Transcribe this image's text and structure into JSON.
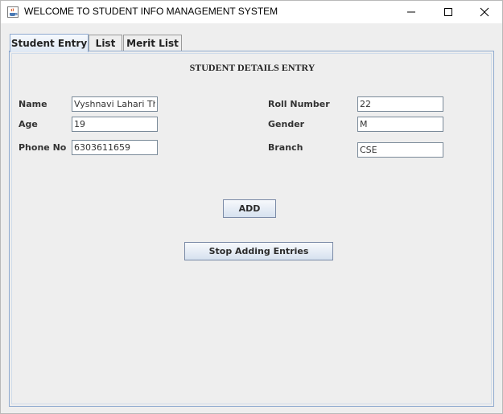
{
  "window": {
    "title": "WELCOME TO STUDENT INFO MANAGEMENT SYSTEM",
    "icon": "java-cup-icon"
  },
  "tabs": [
    {
      "label": "Student Entry",
      "active": true
    },
    {
      "label": "List",
      "active": false
    },
    {
      "label": "Merit List",
      "active": false
    }
  ],
  "form": {
    "heading": "STUDENT DETAILS ENTRY",
    "name": {
      "label": "Name",
      "value": "Vyshnavi Lahari Th"
    },
    "age": {
      "label": "Age",
      "value": "19"
    },
    "phone": {
      "label": "Phone No",
      "value": "6303611659"
    },
    "roll": {
      "label": "Roll Number",
      "value": "22"
    },
    "gender": {
      "label": "Gender",
      "value": "M"
    },
    "branch": {
      "label": "Branch",
      "value": "CSE"
    }
  },
  "buttons": {
    "add": "ADD",
    "stop": "Stop Adding Entries"
  },
  "colors": {
    "tab_accent": "#8faacf",
    "panel_bg": "#eeeeee"
  }
}
